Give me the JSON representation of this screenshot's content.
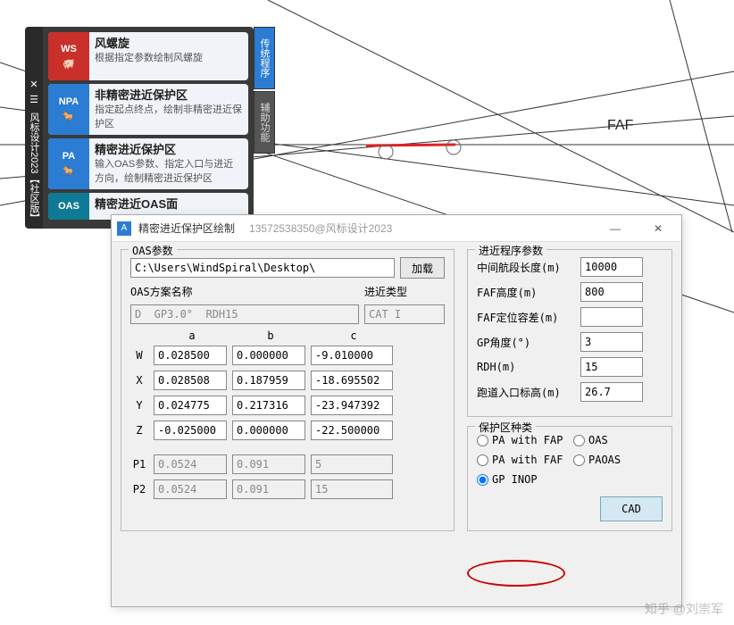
{
  "palette": {
    "vbar_title": "风标设计2023【社区版】",
    "tabs": [
      "传统程序",
      "辅助功能"
    ],
    "items": [
      {
        "badge": "WS",
        "color": "badge-red",
        "title": "风螺旋",
        "desc": "根据指定参数绘制风螺旋"
      },
      {
        "badge": "NPA",
        "color": "badge-blue",
        "title": "非精密进近保护区",
        "desc": "指定起点终点，绘制非精密进近保护区"
      },
      {
        "badge": "PA",
        "color": "badge-blue",
        "title": "精密进近保护区",
        "desc": "输入OAS参数、指定入口与进近方向，绘制精密进近保护区"
      },
      {
        "badge": "OAS",
        "color": "badge-teal",
        "title": "精密进近OAS面",
        "desc": ""
      }
    ]
  },
  "dialog": {
    "title": "精密进近保护区绘制",
    "subtitle": "13572538350@风标设计2023",
    "oas": {
      "group_title": "OAS参数",
      "path": "C:\\Users\\WindSpiral\\Desktop\\",
      "load_btn": "加载",
      "plan_label": "OAS方案名称",
      "type_label": "进近类型",
      "plan_value": "D  GP3.0°  RDH15",
      "type_value": "CAT I",
      "cols": [
        "a",
        "b",
        "c"
      ],
      "rows": [
        {
          "name": "W",
          "a": "0.028500",
          "b": "0.000000",
          "c": "-9.010000"
        },
        {
          "name": "X",
          "a": "0.028508",
          "b": "0.187959",
          "c": "-18.695502"
        },
        {
          "name": "Y",
          "a": "0.024775",
          "b": "0.217316",
          "c": "-23.947392"
        },
        {
          "name": "Z",
          "a": "-0.025000",
          "b": "0.000000",
          "c": "-22.500000"
        }
      ],
      "prows": [
        {
          "name": "P1",
          "a": "0.0524",
          "b": "0.091",
          "c": "5"
        },
        {
          "name": "P2",
          "a": "0.0524",
          "b": "0.091",
          "c": "15"
        }
      ]
    },
    "approach": {
      "group_title": "进近程序参数",
      "fields": [
        {
          "label": "中间航段长度(m)",
          "value": "10000"
        },
        {
          "label": "FAF高度(m)",
          "value": "800"
        },
        {
          "label": "FAF定位容差(m)",
          "value": ""
        },
        {
          "label": "GP角度(°)",
          "value": "3"
        },
        {
          "label": "RDH(m)",
          "value": "15"
        },
        {
          "label": "跑道入口标高(m)",
          "value": "26.7"
        }
      ]
    },
    "prot": {
      "group_title": "保护区种类",
      "options": [
        "PA with FAP",
        "PA with FAF",
        "GP INOP",
        "OAS",
        "PAOAS"
      ],
      "selected": "GP INOP",
      "cad_btn": "CAD"
    }
  },
  "canvas": {
    "faf_label": "FAF"
  },
  "watermark": "知乎 @刘崇军"
}
